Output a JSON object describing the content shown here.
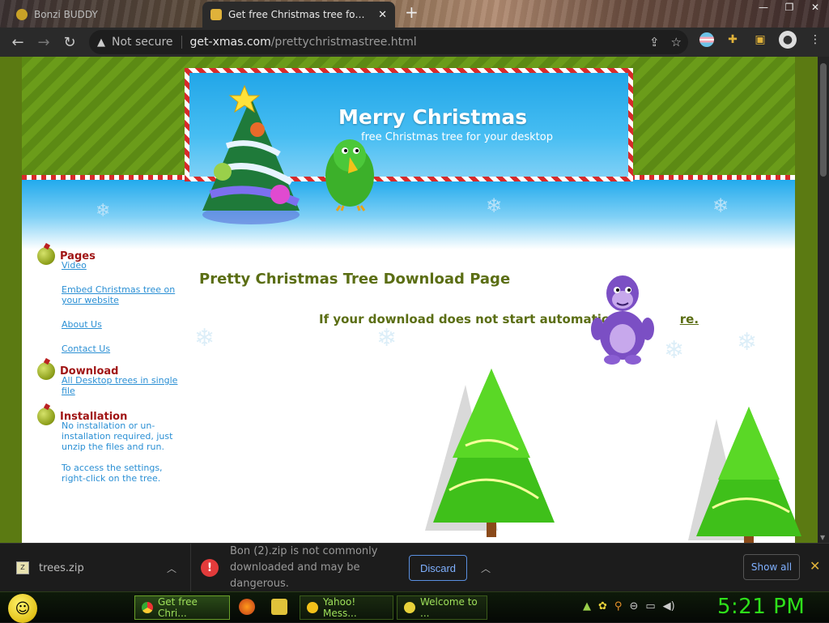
{
  "browser": {
    "tabs": [
      {
        "label": "Bonzi BUDDY",
        "active": false
      },
      {
        "label": "Get free Christmas tree for your",
        "active": true
      }
    ],
    "address": {
      "security_label": "Not secure",
      "host": "get-xmas.com",
      "path": "/prettychristmastree.html"
    }
  },
  "page": {
    "header_title": "Merry Christmas",
    "header_subtitle": "free Christmas tree for your desktop",
    "sidebar": {
      "pages_title": "Pages",
      "pages_links": [
        "Video",
        "Embed Christmas tree on your website",
        "About Us",
        "Contact Us"
      ],
      "download_title": "Download",
      "download_link": "All Desktop trees in single file",
      "installation_title": "Installation",
      "installation_text_1": "No installation or un-installation required, just unzip the files and run.",
      "installation_text_2": "To access the settings, right-click on the tree."
    },
    "content_title": "Pretty Christmas Tree Download Page",
    "content_message": "If your download does not start automatically,",
    "content_link": "re."
  },
  "downloads": {
    "file_name": "trees.zip",
    "warning_text": "Bon (2).zip is not commonly downloaded and may be dangerous.",
    "discard_label": "Discard",
    "show_all_label": "Show all"
  },
  "taskbar": {
    "buttons": [
      {
        "label": "Get free Chri...",
        "active": true
      },
      {
        "label": "Yahoo! Mess...",
        "active": false
      },
      {
        "label": "Welcome to ...",
        "active": false
      }
    ],
    "clock": "5:21 PM"
  },
  "colors": {
    "page_green": "#5b7a12",
    "sidebar_title": "#a01515",
    "link_blue": "#2a8fd4",
    "content_green": "#5b6e14",
    "clock_green": "#2ee01a"
  }
}
